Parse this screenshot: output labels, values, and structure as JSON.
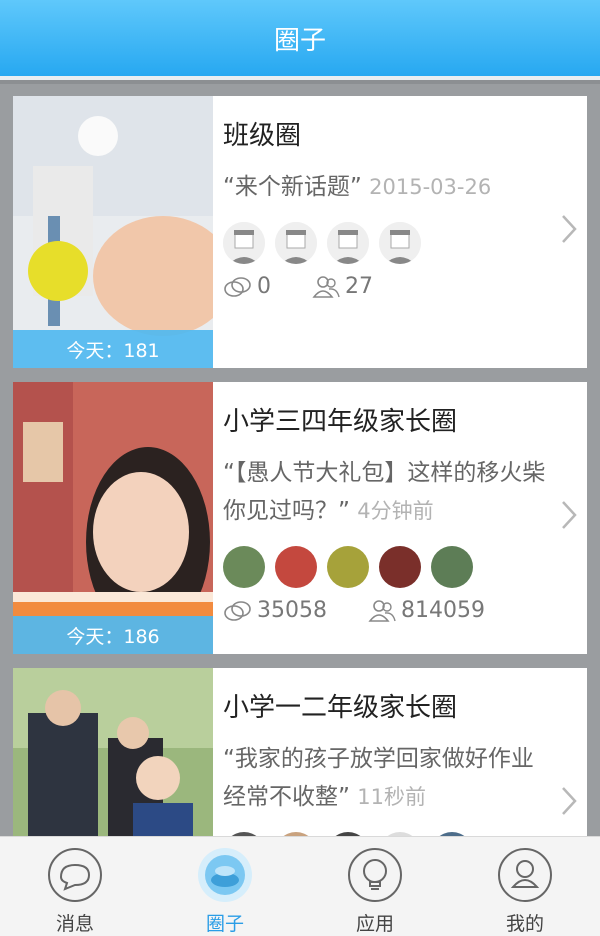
{
  "header": {
    "title": "圈子"
  },
  "cards": [
    {
      "title": "班级圈",
      "topic": "“来个新话题”",
      "time": "2015-03-26",
      "today": "今天：181",
      "comments": "0",
      "members": "27"
    },
    {
      "title": "小学三四年级家长圈",
      "topic": "“【愚人节大礼包】这样的移火柴你见过吗？”",
      "time": "4分钟前",
      "today": "今天：186",
      "comments": "35058",
      "members": "814059"
    },
    {
      "title": "小学一二年级家长圈",
      "topic": "“我家的孩子放学回家做好作业经常不收整”",
      "time": "11秒前"
    }
  ],
  "tabs": [
    {
      "label": "消息",
      "icon": "chat-bubble-icon"
    },
    {
      "label": "圈子",
      "icon": "circle-icon"
    },
    {
      "label": "应用",
      "icon": "lightbulb-icon"
    },
    {
      "label": "我的",
      "icon": "person-icon"
    }
  ],
  "colors": {
    "accent": "#2a9de6",
    "header": "#27a8f1",
    "today_band": "#50b9f0"
  }
}
